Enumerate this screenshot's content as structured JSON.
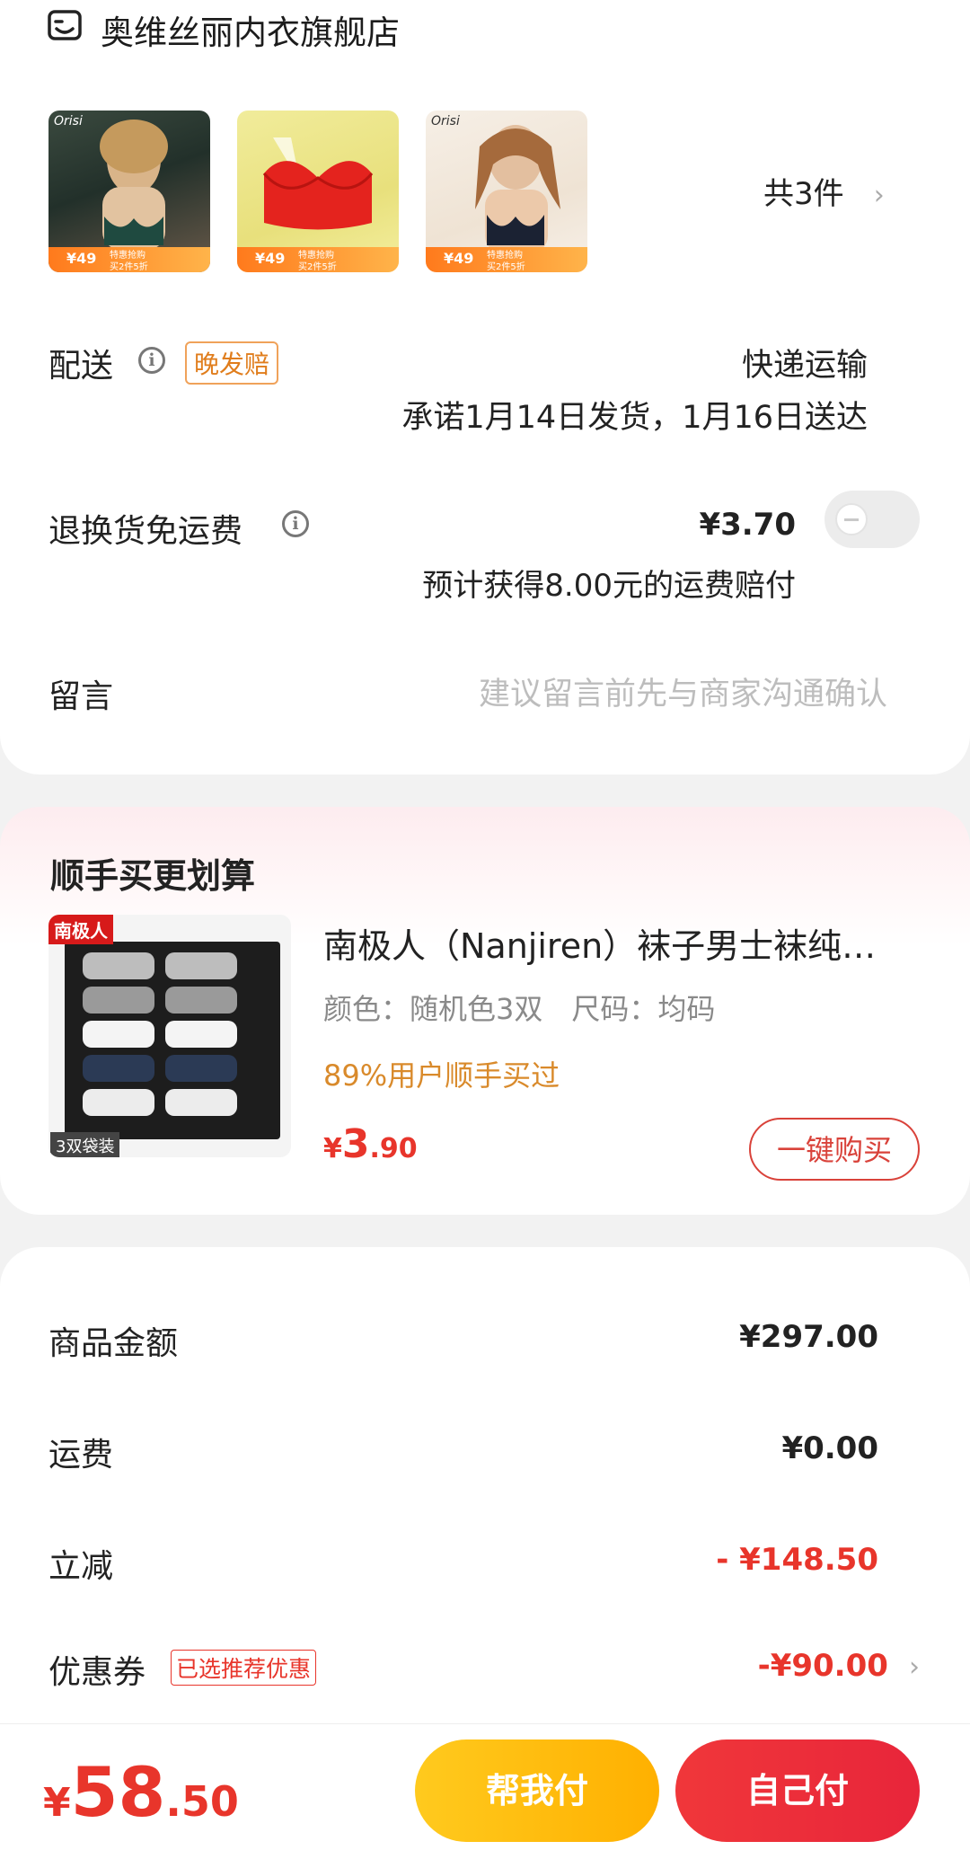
{
  "store": {
    "name": "奥维丝丽内衣旗舰店",
    "icon": "store-icon"
  },
  "products": {
    "thumbs": [
      {
        "brand": "Orisi",
        "tag_price": "¥49",
        "tag_promo_1": "特惠抢购",
        "tag_promo_2": "买2件5折"
      },
      {
        "brand": "",
        "tag_price": "¥49",
        "tag_promo_1": "特惠抢购",
        "tag_promo_2": "买2件5折"
      },
      {
        "brand": "Orisi",
        "tag_price": "¥49",
        "tag_promo_1": "特惠抢购",
        "tag_promo_2": "买2件5折"
      }
    ],
    "count_label": "共3件"
  },
  "delivery": {
    "label": "配送",
    "badge": "晚发赔",
    "method": "快递运输",
    "promise": "承诺1月14日发货，1月16日送达"
  },
  "return_insurance": {
    "label": "退换货免运费",
    "price": "¥3.70",
    "note": "预计获得8.00元的运费赔付",
    "enabled": false
  },
  "message": {
    "label": "留言",
    "placeholder": "建议留言前先与商家沟通确认"
  },
  "upsell": {
    "title": "顺手买更划算",
    "item": {
      "brand_mark": "南极人",
      "pack_label": "3双袋装",
      "name": "南极人（Nanjiren）袜子男士袜纯…",
      "spec": "颜色：随机色3双　尺码：均码",
      "stat": "89%用户顺手买过",
      "price_symbol": "¥",
      "price_int": "3",
      "price_dec": ".90",
      "buy_label": "一键购买"
    }
  },
  "summary": {
    "rows": [
      {
        "label": "商品金额",
        "value": "¥297.00"
      },
      {
        "label": "运费",
        "value": "¥0.00"
      },
      {
        "label": "立减",
        "value": "- ¥148.50"
      },
      {
        "label": "优惠券",
        "badge": "已选推荐优惠",
        "value": "-¥90.00"
      }
    ]
  },
  "footer": {
    "total_symbol": "¥",
    "total_int": "58",
    "total_dec": ".50",
    "help_pay": "帮我付",
    "self_pay": "自己付"
  },
  "colors": {
    "accent_red": "#e8352b",
    "orange": "#e07d1c",
    "help_pay_gradient": [
      "#ffca1e",
      "#ffb000"
    ],
    "self_pay_gradient": [
      "#f0373a",
      "#e8253a"
    ]
  }
}
